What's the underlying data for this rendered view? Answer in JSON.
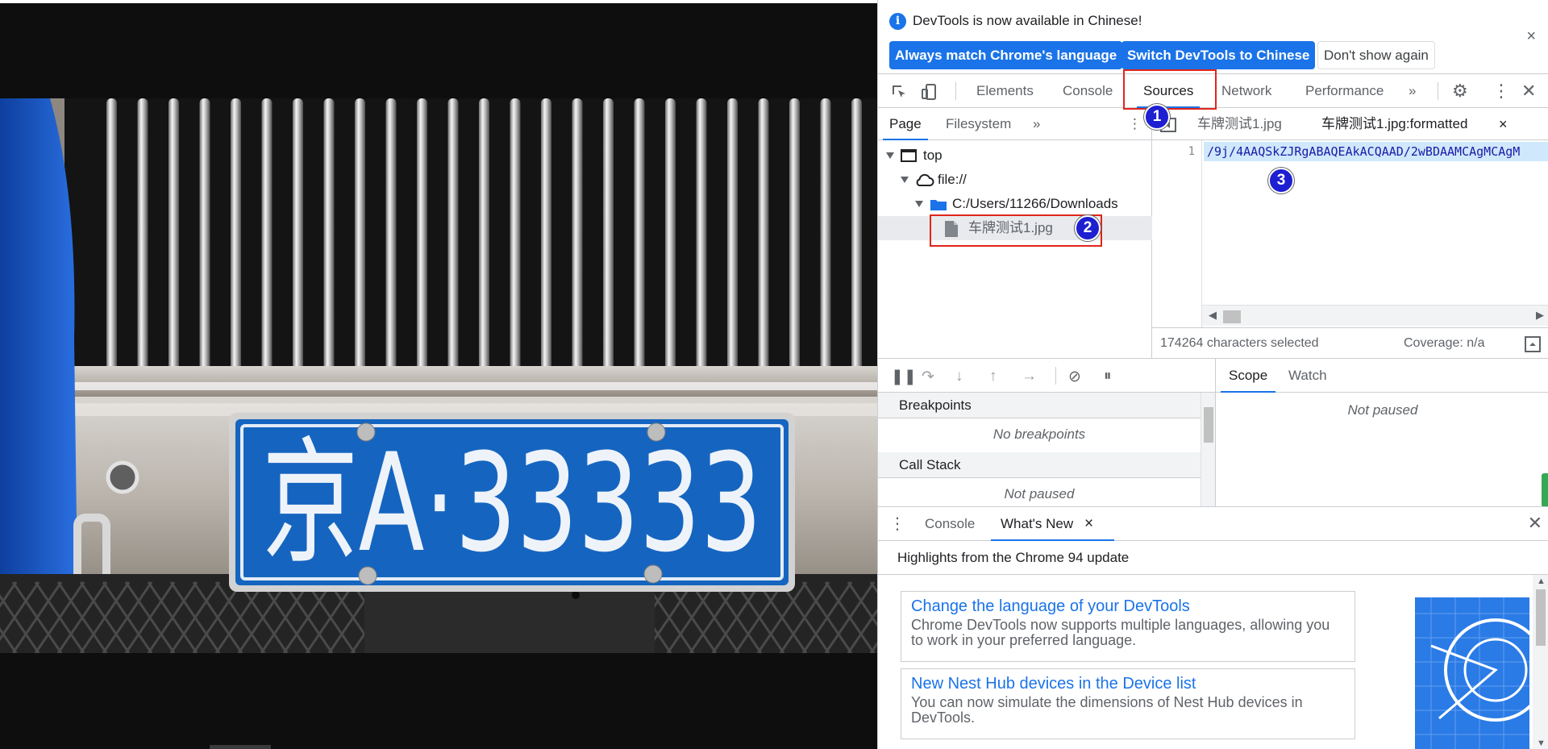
{
  "infobar": {
    "message": "DevTools is now available in Chinese!",
    "buttons": {
      "match": "Always match Chrome's language",
      "switch": "Switch DevTools to Chinese",
      "dismiss": "Don't show again"
    },
    "close": "×"
  },
  "main_tabs": {
    "elements": "Elements",
    "console": "Console",
    "sources": "Sources",
    "network": "Network",
    "performance": "Performance",
    "more": "»"
  },
  "navigator": {
    "tabs": {
      "page": "Page",
      "filesystem": "Filesystem",
      "more": "»"
    },
    "tree": {
      "top": "top",
      "origin": "file://",
      "folder": "C:/Users/11266/Downloads",
      "file": "车牌测试1.jpg"
    }
  },
  "editor": {
    "tabs": {
      "file": "车牌测试1.jpg",
      "formatted": "车牌测试1.jpg:formatted",
      "close": "×"
    },
    "line_number": "1",
    "code": "/9j/4AAQSkZJRgABAQEAkACQAAD/2wBDAAMCAgMCAgM",
    "status": {
      "selection": "174264 characters selected",
      "coverage": "Coverage: n/a"
    }
  },
  "debugger": {
    "breakpoints": {
      "title": "Breakpoints",
      "empty": "No breakpoints"
    },
    "callstack": {
      "title": "Call Stack",
      "empty": "Not paused"
    },
    "right_tabs": {
      "scope": "Scope",
      "watch": "Watch"
    },
    "scope_status": "Not paused"
  },
  "drawer": {
    "tabs": {
      "console": "Console",
      "whatsnew": "What's New",
      "close": "×"
    },
    "highlights": "Highlights from the Chrome 94 update",
    "cards": [
      {
        "title": "Change the language of your DevTools",
        "desc": "Chrome DevTools now supports multiple languages, allowing you to work in your preferred language."
      },
      {
        "title": "New Nest Hub devices in the Device list",
        "desc": "You can now simulate the dimensions of Nest Hub devices in DevTools."
      }
    ]
  },
  "annotations": {
    "badge1": "1",
    "badge2": "2",
    "badge3": "3"
  },
  "photo": {
    "plate": "京A·33333"
  },
  "colors": {
    "accent": "#1a73e8",
    "highlight": "#e1251b",
    "badge": "#1d1fd1",
    "plate_blue": "#1565c0"
  }
}
